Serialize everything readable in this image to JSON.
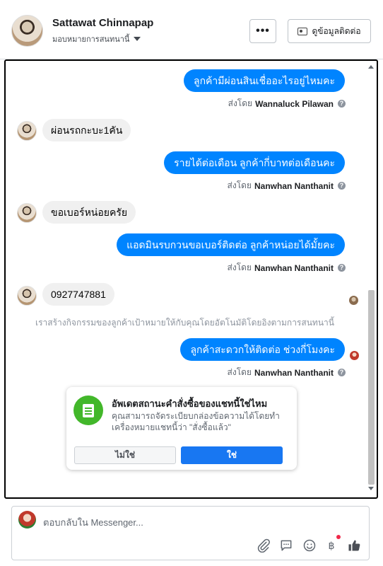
{
  "header": {
    "name": "Sattawat Chinnapap",
    "assign_label": "มอบหมายการสนทนานี้",
    "more_label": "•••",
    "contact_button": "ดูข้อมูลติดต่อ"
  },
  "messages": [
    {
      "id": "m1",
      "direction": "outgoing",
      "text": "ลูกค้ามีผ่อนสินเชื่ออะไรอยู่ไหมคะ",
      "sent_by_prefix": "ส่งโดย",
      "sent_by": "Wannaluck Pilawan"
    },
    {
      "id": "m2",
      "direction": "incoming",
      "text": "ผ่อนรถกะบะ1คัน"
    },
    {
      "id": "m3",
      "direction": "outgoing",
      "text": "รายได้ต่อเดือน ลูกค้ากี่บาทต่อเดือนคะ",
      "sent_by_prefix": "ส่งโดย",
      "sent_by": "Nanwhan Nanthanit"
    },
    {
      "id": "m4",
      "direction": "incoming",
      "text": "ขอเบอร์หน่อยครัย"
    },
    {
      "id": "m5",
      "direction": "outgoing",
      "text": "แอดมินรบกวนขอเบอร์ติดต่อ ลูกค้าหน่อยได้มั้ยคะ",
      "sent_by_prefix": "ส่งโดย",
      "sent_by": "Nanwhan Nanthanit"
    },
    {
      "id": "m6",
      "direction": "incoming",
      "text": "0927747881"
    },
    {
      "id": "m7",
      "direction": "outgoing",
      "text": "ลูกค้าสะดวกให้ติดต่อ ช่วงกี่โมงคะ",
      "sent_by_prefix": "ส่งโดย",
      "sent_by": "Nanwhan Nanthanit"
    }
  ],
  "system_note": "เราสร้างกิจกรรมของลูกค้าเป้าหมายให้กับคุณโดยอัตโนมัติโดยอิงตามการสนทนานี้",
  "order_prompt": {
    "title": "อัพเดตสถานะคำสั่งซื้อของแชทนี้ใช่ไหม",
    "body": "คุณสามารถจัดระเบียบกล่องข้อความได้โดยทำเครื่องหมายแชทนี้ว่า \"สั่งซื้อแล้ว\"",
    "no_label": "ไม่ใช่",
    "yes_label": "ใช่"
  },
  "composer": {
    "placeholder": "ตอบกลับใน Messenger...",
    "tools": [
      "attachment-icon",
      "saved-replies-icon",
      "emoji-icon",
      "payment-icon",
      "like-icon"
    ]
  },
  "colors": {
    "outgoing_bubble": "#0084ff",
    "incoming_bubble": "#f0f0f0",
    "primary_button": "#1877f2",
    "order_icon": "#42b72a",
    "notification_dot": "#f02849"
  },
  "scroll_position": 0.9
}
